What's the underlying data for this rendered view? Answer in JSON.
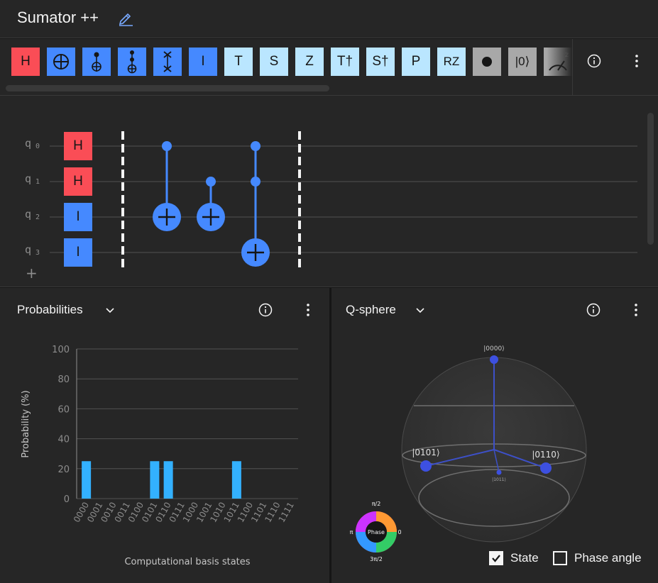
{
  "app": {
    "title": "Sumator ++"
  },
  "toolbar": {
    "gates": [
      {
        "label": "H",
        "kind": "red"
      },
      {
        "label": "",
        "kind": "blue",
        "icon": "cnot-icon"
      },
      {
        "label": "",
        "kind": "blue",
        "icon": "controlled-not-icon"
      },
      {
        "label": "",
        "kind": "blue",
        "icon": "toffoli-icon"
      },
      {
        "label": "",
        "kind": "blue",
        "icon": "swap-icon"
      },
      {
        "label": "I",
        "kind": "blue"
      },
      {
        "label": "T",
        "kind": "light"
      },
      {
        "label": "S",
        "kind": "light"
      },
      {
        "label": "Z",
        "kind": "light"
      },
      {
        "label": "T†",
        "kind": "light"
      },
      {
        "label": "S†",
        "kind": "light"
      },
      {
        "label": "P",
        "kind": "light"
      },
      {
        "label": "RZ",
        "kind": "light"
      },
      {
        "label": "",
        "kind": "gray",
        "icon": "barrier-dot-icon"
      },
      {
        "label": "|0⟩",
        "kind": "gray"
      },
      {
        "label": "",
        "kind": "gray",
        "icon": "measure-icon"
      }
    ],
    "info_icon": "info-icon",
    "overflow_icon": "overflow-menu-icon"
  },
  "circuit": {
    "qubits": [
      {
        "name": "q",
        "index": "0"
      },
      {
        "name": "q",
        "index": "1"
      },
      {
        "name": "q",
        "index": "2"
      },
      {
        "name": "q",
        "index": "3"
      }
    ],
    "first_column_gates": [
      "H",
      "H",
      "I",
      "I"
    ],
    "add_qubit_label": "+"
  },
  "probabilities_panel": {
    "title": "Probabilities",
    "x_title": "Computational basis states",
    "y_title": "Probability (%)"
  },
  "chart_data": {
    "type": "bar",
    "categories": [
      "0000",
      "0001",
      "0010",
      "0011",
      "0100",
      "0101",
      "0110",
      "0111",
      "1000",
      "1001",
      "1010",
      "1011",
      "1100",
      "1101",
      "1110",
      "1111"
    ],
    "values": [
      25,
      0,
      0,
      0,
      0,
      25,
      25,
      0,
      0,
      0,
      0,
      25,
      0,
      0,
      0,
      0
    ],
    "xlabel": "Computational basis states",
    "ylabel": "Probability (%)",
    "yticks": [
      0,
      20,
      40,
      60,
      80,
      100
    ],
    "ylim": [
      0,
      100
    ],
    "bar_color": "#33b1ff"
  },
  "qsphere_panel": {
    "title": "Q-sphere",
    "states": {
      "top": "|0000⟩",
      "left": "|0101⟩",
      "right": "|0110⟩",
      "bottom": "|1011⟩"
    },
    "phase_wheel": {
      "center": "Phase",
      "top": "π/2",
      "right": "0",
      "left": "π",
      "bottom": "3π/2"
    },
    "state_checkbox": {
      "label": "State",
      "checked": true
    },
    "phase_checkbox": {
      "label": "Phase angle",
      "checked": false
    }
  },
  "colors": {
    "accent": "#4589ff",
    "red_gate": "#fa4d56",
    "light_gate": "#bae6ff",
    "bar": "#33b1ff"
  }
}
